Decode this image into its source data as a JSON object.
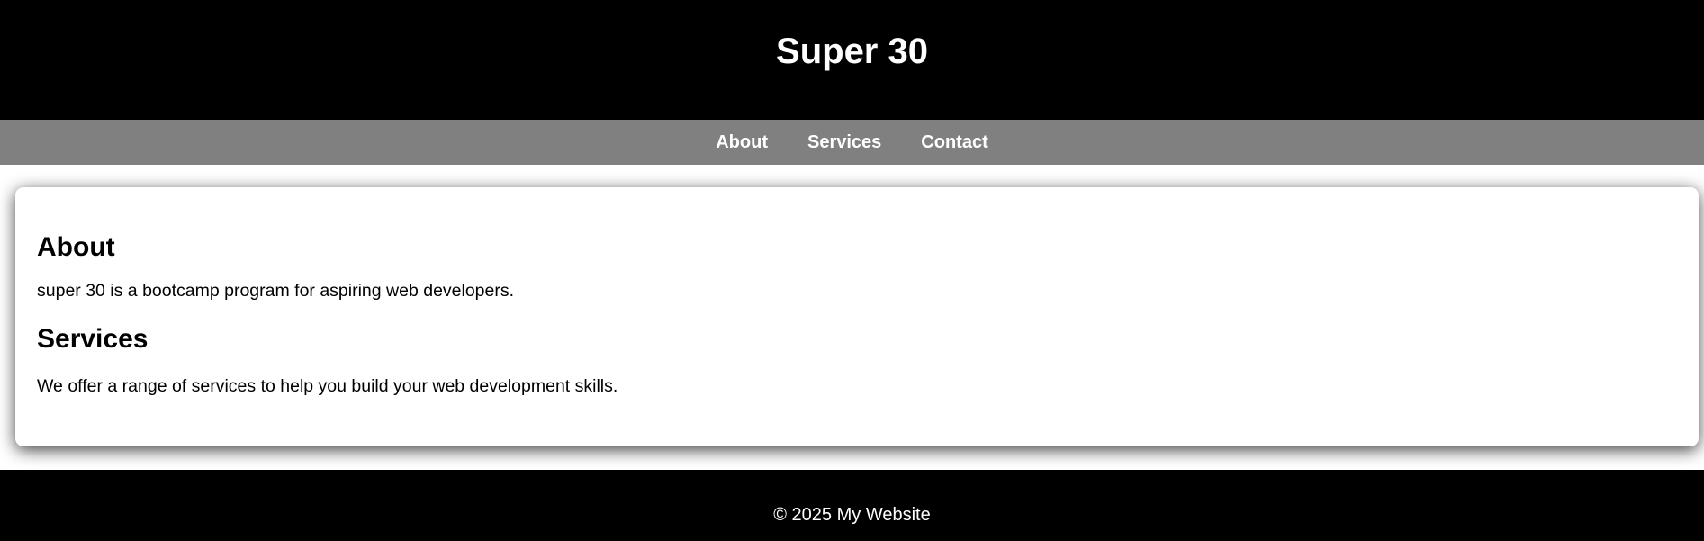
{
  "header": {
    "title": "Super 30"
  },
  "nav": {
    "items": [
      {
        "label": "About"
      },
      {
        "label": "Services"
      },
      {
        "label": "Contact"
      }
    ]
  },
  "main": {
    "about": {
      "heading": "About",
      "text": "super 30 is a bootcamp program for aspiring web developers."
    },
    "services": {
      "heading": "Services",
      "text": "We offer a range of services to help you build your web development skills."
    }
  },
  "footer": {
    "copyright": "© 2025 My Website"
  },
  "colors": {
    "header_bg": "#000000",
    "nav_bg": "#808080",
    "footer_bg": "#000000",
    "text_light": "#ffffff",
    "text_dark": "#000000"
  }
}
